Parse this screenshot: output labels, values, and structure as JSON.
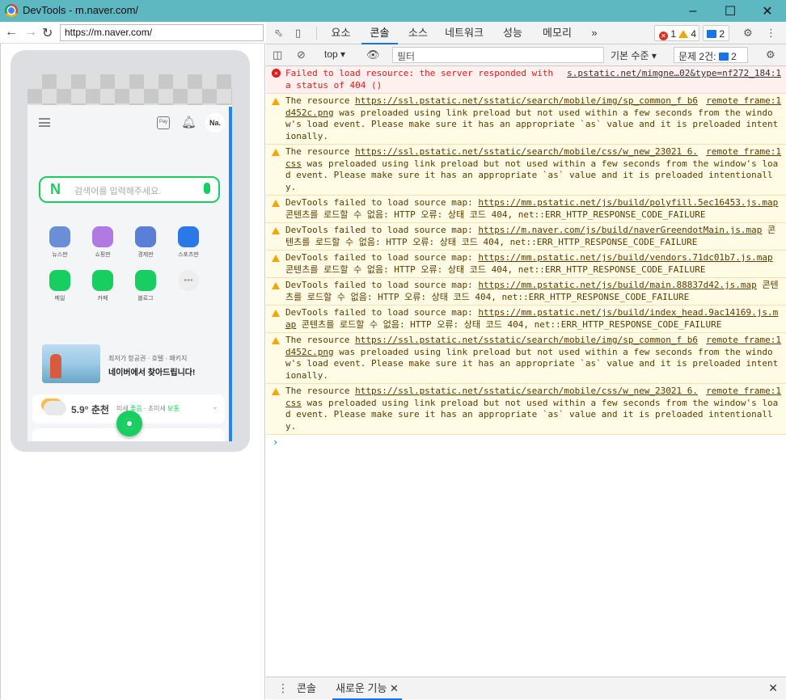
{
  "window": {
    "title": "DevTools - m.naver.com/"
  },
  "browser": {
    "url": "https://m.naver.com/"
  },
  "mobile_page": {
    "search_placeholder": "검색어를 입력해주세요.",
    "avatar_text": "Na.",
    "pay_text": "Pay",
    "services": [
      {
        "label": "뉴스판",
        "icon": "news-icon",
        "color": "#6a8fd8"
      },
      {
        "label": "쇼핑판",
        "icon": "shopping-bag-icon",
        "color": "#b07ae0"
      },
      {
        "label": "경제판",
        "icon": "chart-up-icon",
        "color": "#5a7fd6"
      },
      {
        "label": "스포츠판",
        "icon": "sports-icon",
        "color": "#2b79e8"
      },
      {
        "label": "메일",
        "icon": "mail-icon",
        "color": "#19ce60"
      },
      {
        "label": "카페",
        "icon": "cafe-icon",
        "color": "#19ce60"
      },
      {
        "label": "블로그",
        "icon": "blog-icon",
        "color": "#19ce60"
      },
      {
        "label": "",
        "icon": "more-icon",
        "color": "#eeeeee"
      }
    ],
    "banner_sub": "최저가 항공권 · 호텔 · 패키지",
    "banner_title": "네이버에서 찾아드립니다!",
    "weather_temp": "5.9° 춘천",
    "weather_desc_a": "미세",
    "weather_desc_b": "좋음",
    "weather_desc_c": "· 초미세",
    "weather_desc_d": "보통"
  },
  "devtools": {
    "tabs": [
      "요소",
      "콘솔",
      "소스",
      "네트워크",
      "성능",
      "메모리"
    ],
    "active_tab": "콘솔",
    "more": "»",
    "error_count": "1",
    "warning_count": "4",
    "issue_count": "2",
    "context": "top",
    "filter_placeholder": "필터",
    "level": "기본 수준",
    "issues_label": "문제 2건:",
    "issues_value": "2"
  },
  "console_messages": [
    {
      "level": "error",
      "text": "Failed to load resource: the server responded with a status of 404 ()",
      "source": "s.pstatic.net/mimgne…02&type=nf272_184:1"
    },
    {
      "level": "warning",
      "pre": "The resource ",
      "link": "https://ssl.pstatic.net/sstatic/search/mobile/img/sp_common_f b6d452c.png",
      "post": " was preloaded using link preload but not used within a few seconds from the window's load event. Please make sure it has an appropriate `as` value and it is preloaded intentionally.",
      "source": "remote frame:1"
    },
    {
      "level": "warning",
      "pre": "The resource ",
      "link": "https://ssl.pstatic.net/sstatic/search/mobile/css/w_new_23021 6.css",
      "post": " was preloaded using link preload but not used within a few seconds from the window's load event. Please make sure it has an appropriate `as` value and it is preloaded intentionally.",
      "source": "remote frame:1"
    },
    {
      "level": "warning",
      "pre": "DevTools failed to load source map: ",
      "link": "https://mm.pstatic.net/js/build/polyfill.5ec16453.js.map",
      "post": " 콘텐츠를 로드할 수 없음: HTTP 오류: 상태 코드 404, net::ERR_HTTP_RESPONSE_CODE_FAILURE",
      "source": ""
    },
    {
      "level": "warning",
      "pre": "DevTools failed to load source map: ",
      "link": "https://m.naver.com/js/build/naverGreendotMain.js.map",
      "post": " 콘텐츠를 로드할 수 없음: HTTP 오류: 상태 코드 404, net::ERR_HTTP_RESPONSE_CODE_FAILURE",
      "source": ""
    },
    {
      "level": "warning",
      "pre": "DevTools failed to load source map: ",
      "link": "https://mm.pstatic.net/js/build/vendors.71dc01b7.js.map",
      "post": " 콘텐츠를 로드할 수 없음: HTTP 오류: 상태 코드 404, net::ERR_HTTP_RESPONSE_CODE_FAILURE",
      "source": ""
    },
    {
      "level": "warning",
      "pre": "DevTools failed to load source map: ",
      "link": "https://mm.pstatic.net/js/build/main.88837d42.js.map",
      "post": " 콘텐츠를 로드할 수 없음: HTTP 오류: 상태 코드 404, net::ERR_HTTP_RESPONSE_CODE_FAILURE",
      "source": ""
    },
    {
      "level": "warning",
      "pre": "DevTools failed to load source map: ",
      "link": "https://mm.pstatic.net/js/build/index_head.9ac14169.js.map",
      "post": " 콘텐츠를 로드할 수 없음: HTTP 오류: 상태 코드 404, net::ERR_HTTP_RESPONSE_CODE_FAILURE",
      "source": ""
    },
    {
      "level": "warning",
      "pre": "The resource ",
      "link": "https://ssl.pstatic.net/sstatic/search/mobile/img/sp_common_f b6d452c.png",
      "post": " was preloaded using link preload but not used within a few seconds from the window's load event. Please make sure it has an appropriate `as` value and it is preloaded intentionally.",
      "source": "remote frame:1"
    },
    {
      "level": "warning",
      "pre": "The resource ",
      "link": "https://ssl.pstatic.net/sstatic/search/mobile/css/w_new_23021 6.css",
      "post": " was preloaded using link preload but not used within a few seconds from the window's load event. Please make sure it has an appropriate `as` value and it is preloaded intentionally.",
      "source": "remote frame:1"
    }
  ],
  "drawer": {
    "tabs": [
      "콘솔",
      "새로운 기능"
    ],
    "active_tab": "새로운 기능"
  }
}
